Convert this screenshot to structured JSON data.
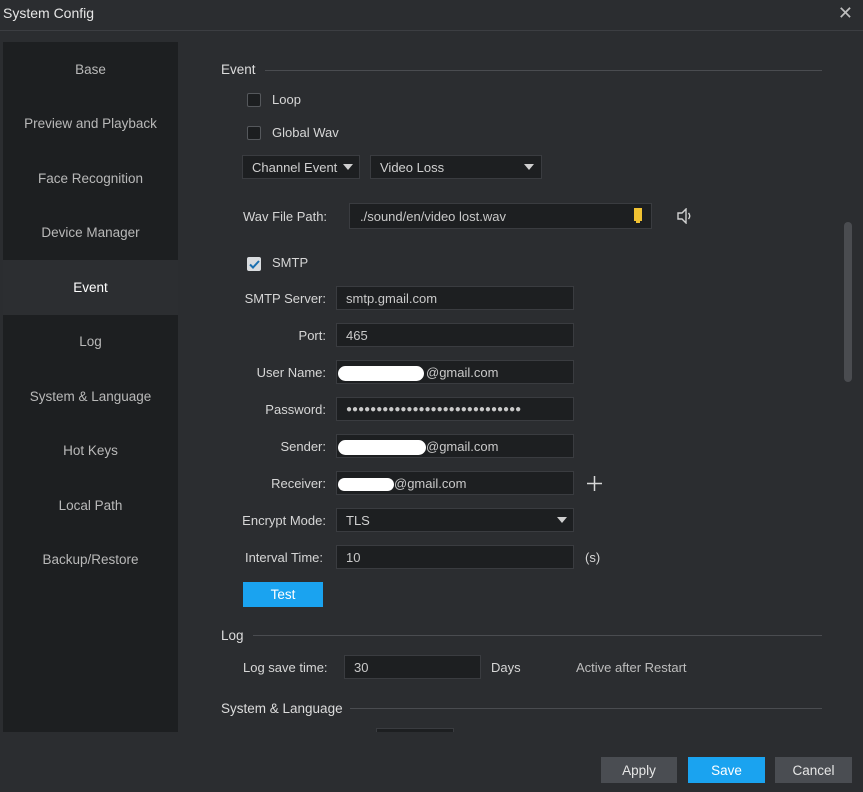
{
  "window": {
    "title": "System Config",
    "close_icon": "close-icon"
  },
  "sidebar": {
    "items": [
      {
        "label": "Base",
        "active": false
      },
      {
        "label": "Preview and Playback",
        "active": false
      },
      {
        "label": "Face Recognition",
        "active": false
      },
      {
        "label": "Device Manager",
        "active": false
      },
      {
        "label": "Event",
        "active": true
      },
      {
        "label": "Log",
        "active": false
      },
      {
        "label": "System & Language",
        "active": false
      },
      {
        "label": "Hot Keys",
        "active": false
      },
      {
        "label": "Local Path",
        "active": false
      },
      {
        "label": "Backup/Restore",
        "active": false
      }
    ]
  },
  "event": {
    "section_title": "Event",
    "loop_label": "Loop",
    "loop_checked": false,
    "global_wav_label": "Global Wav",
    "global_wav_checked": false,
    "event_type_select": "Channel Event",
    "event_select": "Video Loss",
    "wav_path_label": "Wav File Path:",
    "wav_path_value": "./sound/en/video lost.wav",
    "smtp_label": "SMTP",
    "smtp_checked": true,
    "smtp_server_label": "SMTP Server:",
    "smtp_server_value": "smtp.gmail.com",
    "port_label": "Port:",
    "port_value": "465",
    "username_label": "User Name:",
    "username_value": "@gmail.com",
    "password_label": "Password:",
    "password_value": "●●●●●●●●●●●●●●●●●●●●●●●●●●●●●",
    "sender_label": "Sender:",
    "sender_value": "@gmail.com",
    "receiver_label": "Receiver:",
    "receiver_value": "@gmail.com",
    "encrypt_label": "Encrypt Mode:",
    "encrypt_value": "TLS",
    "interval_label": "Interval Time:",
    "interval_value": "10",
    "interval_unit": "(s)",
    "test_button": "Test"
  },
  "log": {
    "section_title": "Log",
    "save_time_label": "Log save time:",
    "save_time_value": "30",
    "save_time_unit": "Days",
    "note": "Active after Restart"
  },
  "system_language": {
    "section_title": "System & Language"
  },
  "footer": {
    "apply": "Apply",
    "save": "Save",
    "cancel": "Cancel"
  },
  "colors": {
    "accent": "#1aa3f0",
    "sidebar_bg": "#1d1f21",
    "panel_bg": "#2b2d30"
  }
}
